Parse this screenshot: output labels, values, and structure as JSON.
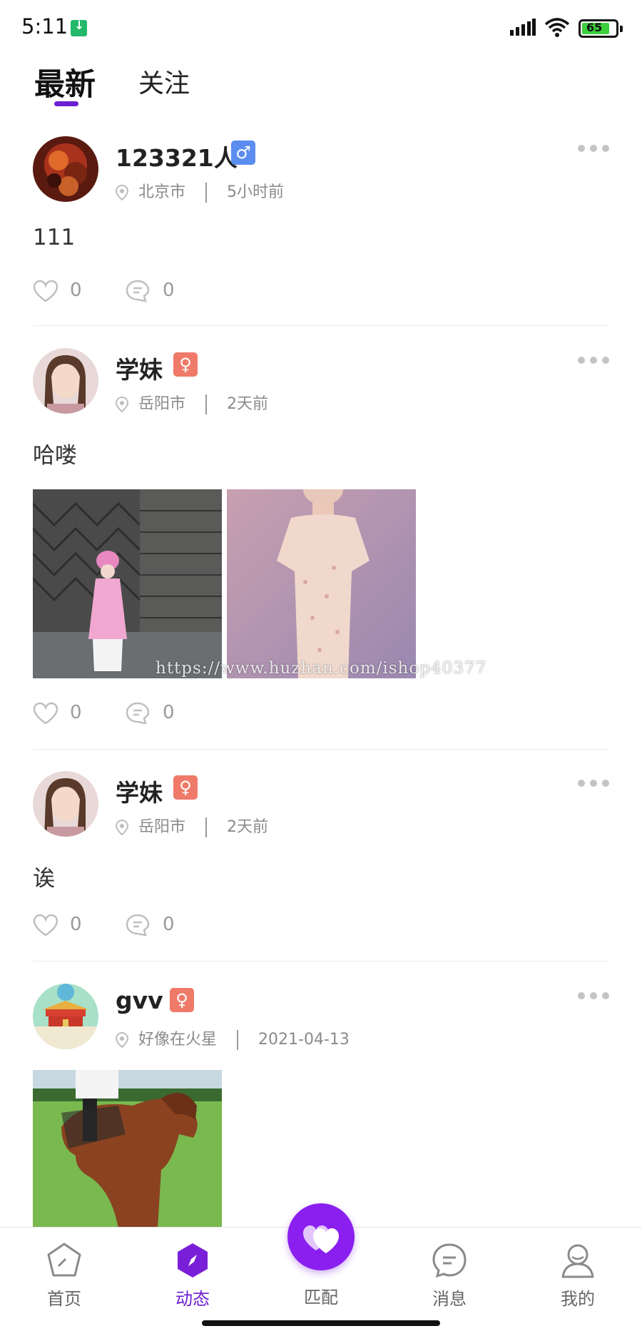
{
  "status_bar": {
    "time": "5:11",
    "battery": "65",
    "icons": [
      "download-icon",
      "signal-icon",
      "wifi-icon",
      "battery-icon"
    ]
  },
  "tabs": [
    {
      "label": "最新",
      "active": true
    },
    {
      "label": "关注",
      "active": false
    }
  ],
  "colors": {
    "accent": "#6a1fd1",
    "male_badge": "#5b8cf0",
    "female_badge": "#f07a6a",
    "match_button": "#8a1ff0"
  },
  "posts": [
    {
      "username": "123321人",
      "gender": "male",
      "gender_symbol": "♂",
      "location": "北京市",
      "time": "5小时前",
      "content": "111",
      "likes": "0",
      "comments": "0"
    },
    {
      "username": "学妹",
      "gender": "female",
      "gender_symbol": "♀",
      "location": "岳阳市",
      "time": "2天前",
      "content": "哈喽",
      "likes": "0",
      "comments": "0"
    },
    {
      "username": "学妹",
      "gender": "female",
      "gender_symbol": "♀",
      "location": "岳阳市",
      "time": "2天前",
      "content": "诶",
      "likes": "0",
      "comments": "0"
    },
    {
      "username": "gvv",
      "gender": "female",
      "gender_symbol": "♀",
      "location": "好像在火星",
      "time": "2021-04-13"
    }
  ],
  "watermark": "https://www.huzhan.com/ishop40377",
  "bottom_nav": [
    {
      "label": "首页",
      "icon": "home-icon",
      "active": false
    },
    {
      "label": "动态",
      "icon": "compass-icon",
      "active": true
    },
    {
      "label": "匹配",
      "icon": "heart-match-icon",
      "active": false
    },
    {
      "label": "消息",
      "icon": "message-icon",
      "active": false
    },
    {
      "label": "我的",
      "icon": "profile-icon",
      "active": false
    }
  ]
}
